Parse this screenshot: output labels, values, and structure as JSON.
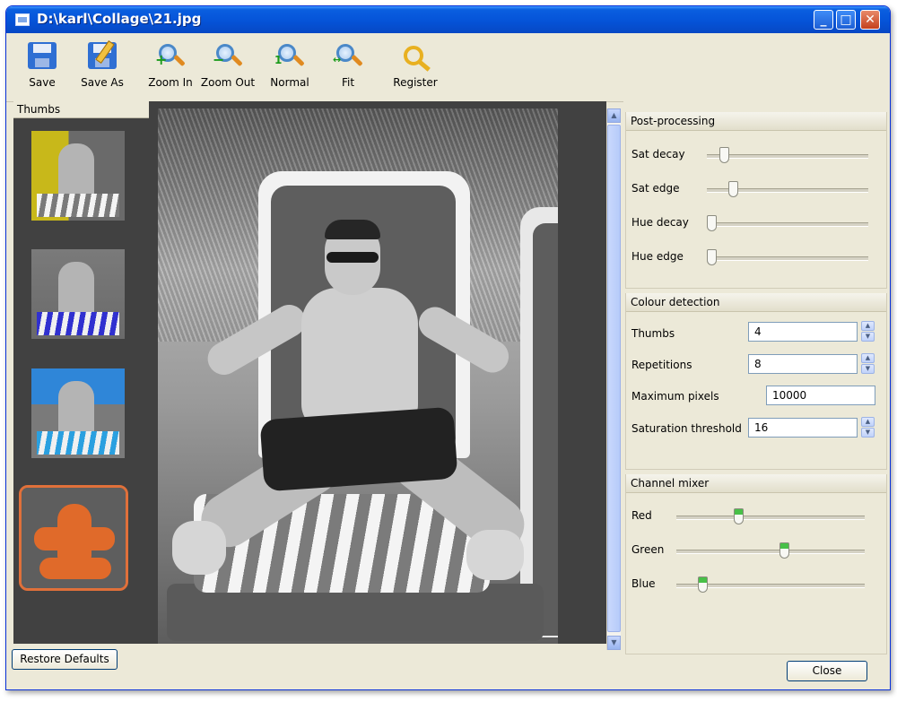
{
  "window": {
    "title": "D:\\karl\\Collage\\21.jpg"
  },
  "toolbar": {
    "items": [
      {
        "label": "Save",
        "icon": "floppy-disk-icon"
      },
      {
        "label": "Save As",
        "icon": "floppy-disk-pen-icon"
      },
      {
        "label": "Zoom In",
        "icon": "zoom-in-icon"
      },
      {
        "label": "Zoom Out",
        "icon": "zoom-out-icon"
      },
      {
        "label": "Normal",
        "icon": "zoom-normal-icon"
      },
      {
        "label": "Fit",
        "icon": "zoom-fit-icon"
      },
      {
        "label": "Register",
        "icon": "key-icon"
      }
    ]
  },
  "thumbs": {
    "header": "Thumbs",
    "count": 4,
    "selected_index": 3
  },
  "post_processing": {
    "header": "Post-processing",
    "sliders": [
      {
        "label": "Sat decay",
        "value": 0.08
      },
      {
        "label": "Sat edge",
        "value": 0.14
      },
      {
        "label": "Hue decay",
        "value": 0.0
      },
      {
        "label": "Hue edge",
        "value": 0.0
      }
    ]
  },
  "colour_detection": {
    "header": "Colour detection",
    "fields": [
      {
        "label": "Thumbs",
        "value": "4"
      },
      {
        "label": "Repetitions",
        "value": "8"
      },
      {
        "label": "Maximum pixels",
        "value": "10000"
      },
      {
        "label": "Saturation threshold",
        "value": "16"
      }
    ]
  },
  "channel_mixer": {
    "header": "Channel mixer",
    "sliders": [
      {
        "label": "Red",
        "value": 0.32
      },
      {
        "label": "Green",
        "value": 0.58
      },
      {
        "label": "Blue",
        "value": 0.12
      }
    ]
  },
  "footer": {
    "restore_label": "Restore Defaults",
    "close_label": "Close"
  },
  "colors": {
    "titlebar": "#0553d8",
    "panel": "#ece9d8",
    "thumb_selected_border": "#e0703a"
  }
}
